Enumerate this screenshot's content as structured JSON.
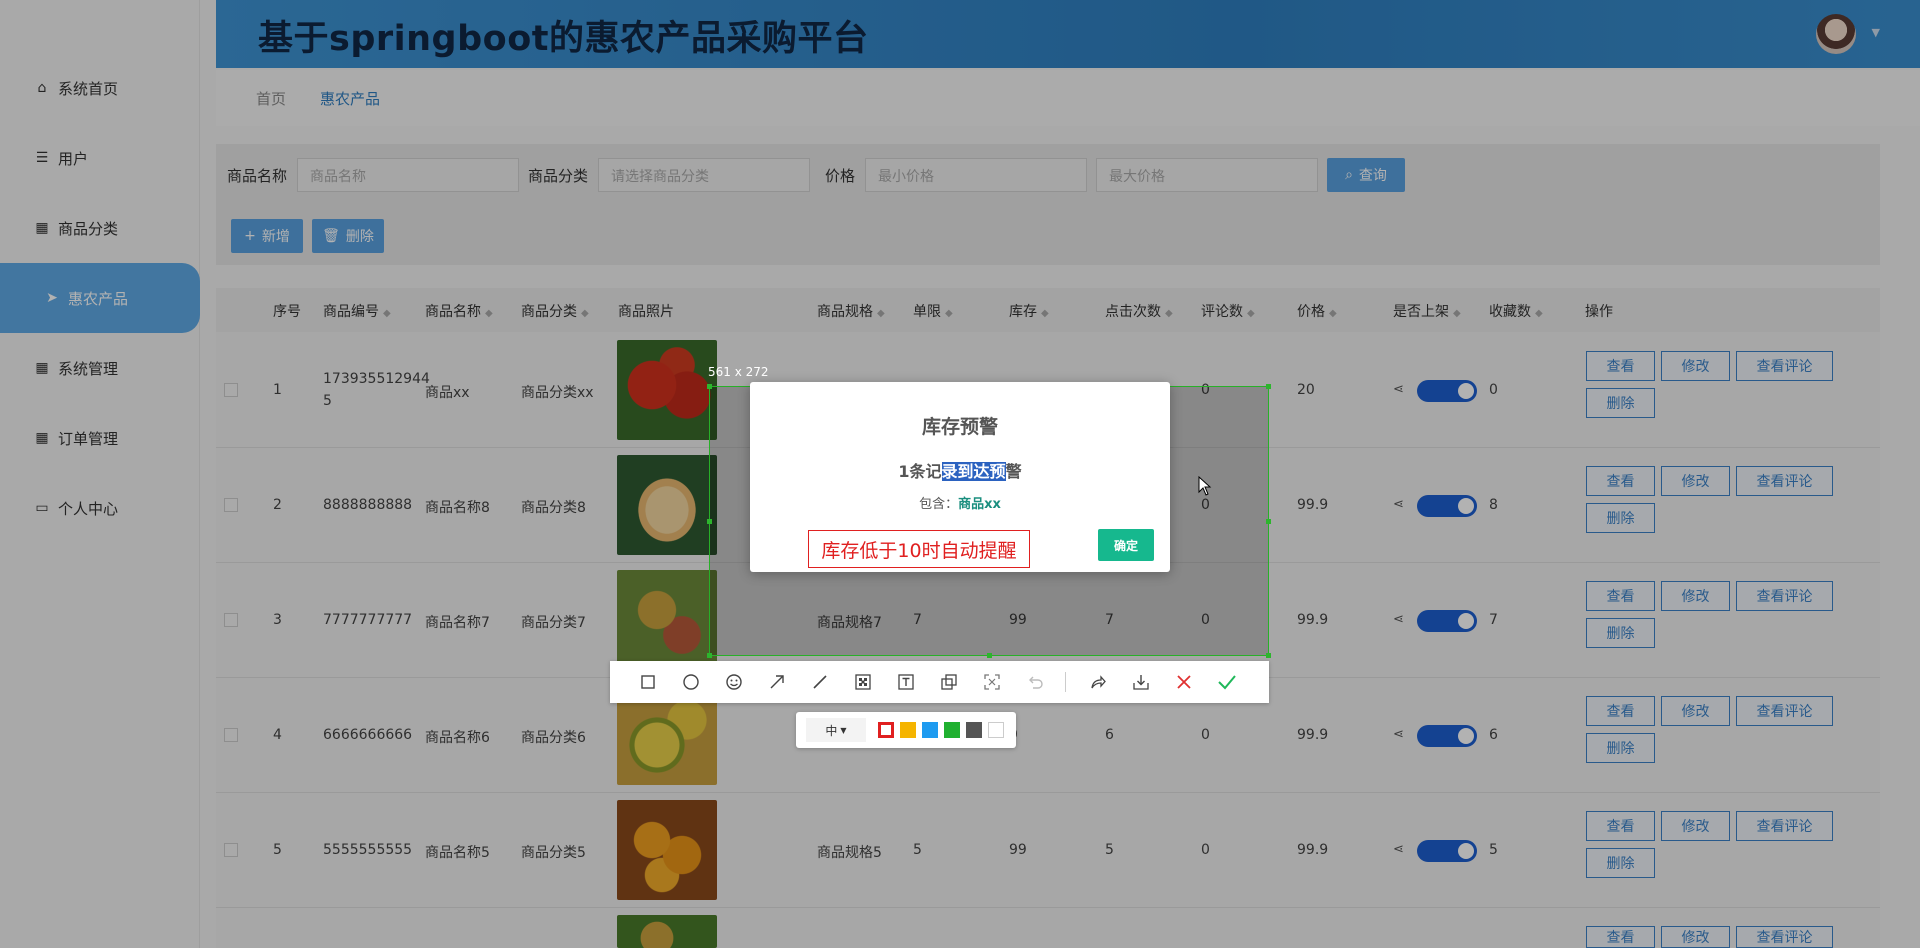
{
  "app": {
    "title": "基于springboot的惠农产品采购平台"
  },
  "sidebar": {
    "items": [
      {
        "label": "系统首页",
        "icon": "home-icon",
        "glyph": "⌂"
      },
      {
        "label": "用户",
        "icon": "list-icon",
        "glyph": "☰"
      },
      {
        "label": "商品分类",
        "icon": "grid-icon",
        "glyph": "▦"
      },
      {
        "label": "惠农产品",
        "icon": "send-icon",
        "glyph": "➤",
        "active": true
      },
      {
        "label": "系统管理",
        "icon": "grid-icon",
        "glyph": "▦"
      },
      {
        "label": "订单管理",
        "icon": "grid-icon",
        "glyph": "▦"
      },
      {
        "label": "个人中心",
        "icon": "card-icon",
        "glyph": "▭"
      }
    ]
  },
  "breadcrumb": {
    "home": "首页",
    "current": "惠农产品"
  },
  "search": {
    "name_label": "商品名称",
    "name_placeholder": "商品名称",
    "category_label": "商品分类",
    "category_placeholder": "请选择商品分类",
    "price_label": "价格",
    "min_placeholder": "最小价格",
    "max_placeholder": "最大价格",
    "query_button": "查询"
  },
  "actions": {
    "add": "新增",
    "delete": "删除"
  },
  "table": {
    "columns": [
      "序号",
      "商品编号",
      "商品名称",
      "商品分类",
      "商品照片",
      "商品规格",
      "单限",
      "库存",
      "点击次数",
      "评论数",
      "价格",
      "是否上架",
      "收藏数",
      "操作"
    ],
    "rows": [
      {
        "idx": "1",
        "code": "173935512944",
        "code2": "5",
        "name": "商品xx",
        "category": "商品分类xx",
        "spec": "",
        "limit": "",
        "stock": "",
        "clicks": "",
        "comments": "0",
        "price": "20",
        "favorites": "0"
      },
      {
        "idx": "2",
        "code": "8888888888",
        "code2": "",
        "name": "商品名称8",
        "category": "商品分类8",
        "spec": "",
        "limit": "",
        "stock": "",
        "clicks": "",
        "comments": "0",
        "price": "99.9",
        "favorites": "8"
      },
      {
        "idx": "3",
        "code": "7777777777",
        "code2": "",
        "name": "商品名称7",
        "category": "商品分类7",
        "spec": "商品规格7",
        "limit": "7",
        "stock": "99",
        "clicks": "7",
        "comments": "0",
        "price": "99.9",
        "favorites": "7"
      },
      {
        "idx": "4",
        "code": "6666666666",
        "code2": "",
        "name": "商品名称6",
        "category": "商品分类6",
        "spec": "",
        "limit": "",
        "stock": "9",
        "clicks": "6",
        "comments": "0",
        "price": "99.9",
        "favorites": "6"
      },
      {
        "idx": "5",
        "code": "5555555555",
        "code2": "",
        "name": "商品名称5",
        "category": "商品分类5",
        "spec": "商品规格5",
        "limit": "5",
        "stock": "99",
        "clicks": "5",
        "comments": "0",
        "price": "99.9",
        "favorites": "5"
      }
    ],
    "ops": {
      "view": "查看",
      "edit": "修改",
      "reviews": "查看评论",
      "delete": "删除"
    }
  },
  "capture": {
    "size_text": "561 x 272"
  },
  "dialog": {
    "title": "库存预警",
    "msg_pre": "1条记",
    "msg_hl": "录到达预",
    "msg_post": "警",
    "include_label": "包含：",
    "include_product": "商品xx",
    "note": "库存低于10时自动提醒",
    "ok": "确定"
  },
  "toolbar": {
    "tools": [
      "rectangle-icon",
      "ellipse-icon",
      "emoji-icon",
      "arrow-icon",
      "pen-icon",
      "mosaic-icon",
      "text-icon",
      "copy-icon",
      "ocr-icon",
      "undo-icon",
      "share-icon",
      "save-icon",
      "cancel-icon",
      "confirm-icon"
    ],
    "size_label": "中",
    "colors": [
      "#e02020",
      "#f5b400",
      "#1e9bf0",
      "#20b030",
      "#555555",
      "#ffffff"
    ]
  }
}
